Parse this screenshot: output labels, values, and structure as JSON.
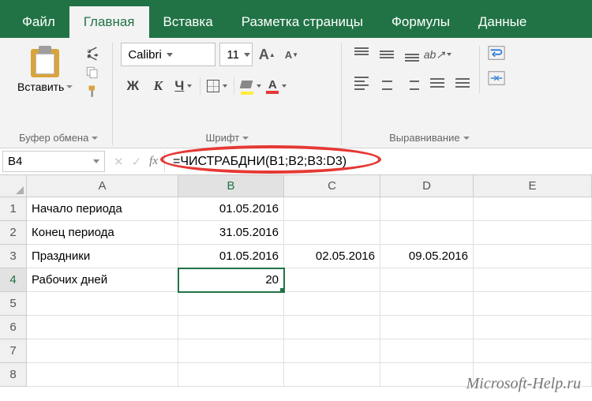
{
  "tabs": {
    "file": "Файл",
    "home": "Главная",
    "insert": "Вставка",
    "layout": "Разметка страницы",
    "formulas": "Формулы",
    "data": "Данные"
  },
  "ribbon": {
    "paste": "Вставить",
    "clipboard_group": "Буфер обмена",
    "font_group": "Шрифт",
    "alignment_group": "Выравнивание",
    "font_name": "Calibri",
    "font_size": "11",
    "grow_font": "A",
    "shrink_font": "A",
    "bold": "Ж",
    "italic": "К",
    "underline": "Ч",
    "font_color_letter": "A"
  },
  "formula_bar": {
    "cell_ref": "B4",
    "fx": "fx",
    "formula": "=ЧИСТРАБДНИ(B1;B2;B3:D3)"
  },
  "columns": [
    "A",
    "B",
    "C",
    "D",
    "E"
  ],
  "rowcount": 8,
  "cells": {
    "A1": "Начало периода",
    "B1": "01.05.2016",
    "A2": "Конец периода",
    "B2": "31.05.2016",
    "A3": "Праздники",
    "B3": "01.05.2016",
    "C3": "02.05.2016",
    "D3": "09.05.2016",
    "A4": "Рабочих дней",
    "B4": "20"
  },
  "watermark": "Microsoft-Help.ru"
}
